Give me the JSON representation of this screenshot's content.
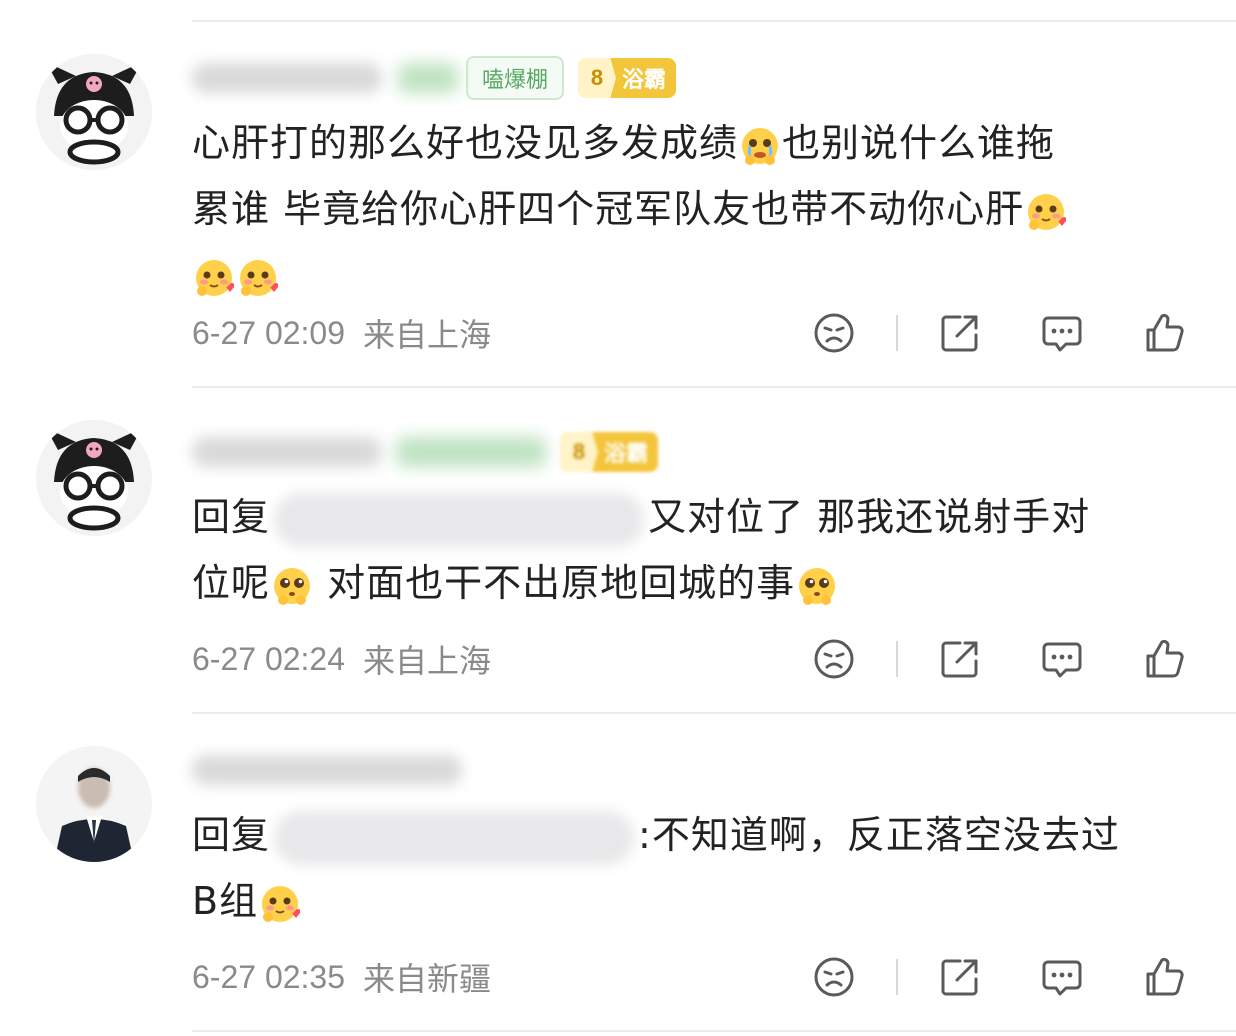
{
  "comments": [
    {
      "badge_fire": "嗑爆棚",
      "badge_level_num": "8",
      "badge_level_text": "浴霸",
      "text_line1": "心肝打的那么好也没见多发成绩",
      "text_line1b": "也别说什么谁拖",
      "text_line2": "累谁 毕竟给你心肝四个冠军队友也带不动你心肝",
      "time": "6-27 02:09",
      "location": "来自上海"
    },
    {
      "badge_level_num": "8",
      "badge_level_text": "浴霸",
      "reply_prefix": "回复",
      "text_line1": "又对位了 那我还说射手对",
      "text_line2a": "位呢",
      "text_line2b": " 对面也干不出原地回城的事",
      "time": "6-27 02:24",
      "location": "来自上海"
    },
    {
      "reply_prefix": "回复",
      "text_line1": ":不知道啊，反正落空没去过",
      "text_line2": "B组",
      "time": "6-27 02:35",
      "location": "来自新疆"
    }
  ],
  "icons": {
    "dislike": "sad-face-icon",
    "share": "share-icon",
    "comment": "comment-bubble-icon",
    "like": "thumbs-up-icon",
    "emoji_1": "crying-face-emoji",
    "emoji_2": "blushing-heart-emoji",
    "emoji_3": "pleading-face-emoji"
  },
  "colors": {
    "text": "#222222",
    "meta": "#8a8a8a",
    "badge_green": "#5aa865",
    "badge_gold": "#f3c53a"
  }
}
